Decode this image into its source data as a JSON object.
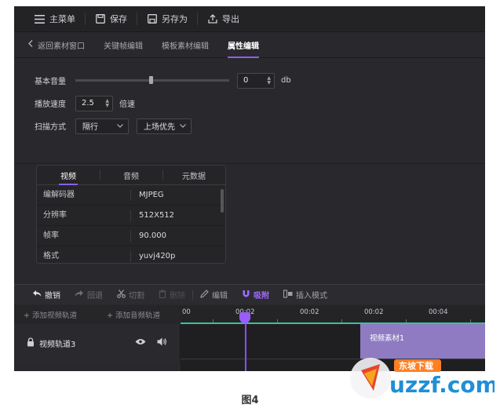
{
  "toolbar": {
    "items": [
      {
        "icon": "menu-icon",
        "label": "主菜单"
      },
      {
        "icon": "save-icon",
        "label": "保存"
      },
      {
        "icon": "save-as-icon",
        "label": "另存为"
      },
      {
        "icon": "export-icon",
        "label": "导出"
      }
    ]
  },
  "tabs": {
    "back": "返回素材窗口",
    "items": [
      "关键帧编辑",
      "模板素材编辑",
      "属性编辑"
    ],
    "active": "属性编辑"
  },
  "properties": {
    "volume_label": "基本音量",
    "volume_value": "0",
    "volume_unit": "db",
    "volume_level_percent": 49,
    "speed_label": "播放速度",
    "speed_value": "2.5",
    "speed_unit": "倍速",
    "scan_label": "扫描方式",
    "scan_mode": "隔行",
    "field_order": "上场优先"
  },
  "metadata": {
    "tabs": [
      "视频",
      "音频",
      "元数据"
    ],
    "active_tab": "视频",
    "rows": [
      {
        "key": "编解码器",
        "value": "MJPEG"
      },
      {
        "key": "分辨率",
        "value": "512X512"
      },
      {
        "key": "帧率",
        "value": "90.000"
      },
      {
        "key": "格式",
        "value": "yuvj420p"
      }
    ]
  },
  "edit_toolbar": {
    "undo": "撤销",
    "redo": "回退",
    "cut": "切割",
    "delete": "删除",
    "edit": "编辑",
    "snap": "吸附",
    "insert_mode": "插入模式"
  },
  "timeline": {
    "add_video_track": "添加视频轨道",
    "add_audio_track": "添加音频轨道",
    "ruler_labels": [
      "00",
      "00:02",
      "00:02",
      "00:02",
      "00:04"
    ],
    "track_name": "视频轨道3",
    "clip_label": "视频素材1"
  },
  "caption": "图4",
  "watermark": {
    "brand": "uzzf.com",
    "tag": "东坡下载"
  },
  "colors": {
    "accent": "#8e5cf0",
    "clip": "#8f7bc2",
    "ruler_line": "#3fbf9d",
    "background": "#29292d"
  }
}
